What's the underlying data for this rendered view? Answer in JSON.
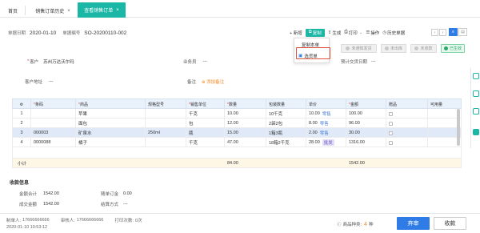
{
  "tabs": [
    {
      "label": "首页",
      "closable": false,
      "active": false
    },
    {
      "label": "销售订单历史",
      "closable": true,
      "active": false
    },
    {
      "label": "查看销售订单",
      "closable": true,
      "active": true
    }
  ],
  "doc": {
    "date_label": "单据日期",
    "date_value": "2020-01-10",
    "no_label": "单据编号",
    "no_value": "SO-20200110-002"
  },
  "toolbar": {
    "new": "+ 新增",
    "copy": "复制",
    "generate": "生成",
    "print": "打印",
    "operate": "操作",
    "history": "历史单据"
  },
  "dropdown": {
    "items": [
      "复制本单",
      "选货单"
    ]
  },
  "status_buttons": [
    {
      "label": "未通知发货"
    },
    {
      "label": "未出库"
    },
    {
      "label": "未收款"
    },
    {
      "label": "已生效"
    }
  ],
  "form": {
    "customer_label": "客户",
    "customer_value": "苏州万达沃尔玛",
    "salesperson_label": "业务员",
    "salesperson_value": "---",
    "delivery_date_label": "预计交货日期",
    "delivery_date_value": "---",
    "address_label": "客户地址",
    "address_value": "---",
    "remark_label": "备注",
    "remark_action": "添加备注"
  },
  "table": {
    "headers": [
      "",
      "条码",
      "商品",
      "规格型号",
      "销售单位",
      "数量",
      "包装数量",
      "单价",
      "金额",
      "赠品",
      "可用量"
    ],
    "rows": [
      {
        "idx": "1",
        "barcode": "",
        "product": "苹果",
        "spec": "",
        "unit": "千克",
        "qty": "10.00",
        "pack": "10千克",
        "price": "10.00",
        "tag": "零售",
        "amount": "100.00",
        "gift": "",
        "avail": ""
      },
      {
        "idx": "2",
        "barcode": "",
        "product": "面包",
        "spec": "",
        "unit": "包",
        "qty": "12.00",
        "pack": "2袋2包",
        "price": "8.00",
        "tag": "零售",
        "amount": "96.00",
        "gift": "",
        "avail": ""
      },
      {
        "idx": "3",
        "barcode": "000003",
        "product": "矿泉水",
        "spec": "250ml",
        "unit": "瓶",
        "qty": "15.00",
        "pack": "1箱3瓶",
        "price": "2.00",
        "tag": "零售",
        "amount": "30.00",
        "gift": "",
        "avail": ""
      },
      {
        "idx": "4",
        "barcode": "0000088",
        "product": "橘子",
        "spec": "",
        "unit": "千克",
        "qty": "47.00",
        "pack": "18箱2千克",
        "price": "28.00",
        "tag": "批发",
        "amount": "1316.00",
        "gift": "",
        "avail": ""
      }
    ],
    "subtotal_label": "小计",
    "subtotal_qty": "84.00",
    "subtotal_amount": "1542.00"
  },
  "receipt": {
    "title": "收款信息",
    "total_label": "金额合计",
    "total_value": "1542.00",
    "deposit_label": "随单订金",
    "deposit_value": "0.00",
    "deal_label": "成交金额",
    "deal_value": "1542.00",
    "settle_label": "结算方式",
    "settle_value": "---"
  },
  "footer": {
    "maker_label": "制单人:",
    "maker_value": "17666666666",
    "auditor_label": "审核人:",
    "auditor_value": "17666666666",
    "print_label": "打印次数:",
    "print_value": "0次",
    "time_value": "2020-01-10 10:53:12",
    "kinds_label": "商品种类:",
    "kinds_value": "4",
    "kinds_unit": "种",
    "audit_btn": "弃审",
    "collect_btn": "收款"
  },
  "colors": {
    "accent": "#1bb7a6",
    "primary": "#2f7ce6",
    "highlight": "#e0533b"
  }
}
